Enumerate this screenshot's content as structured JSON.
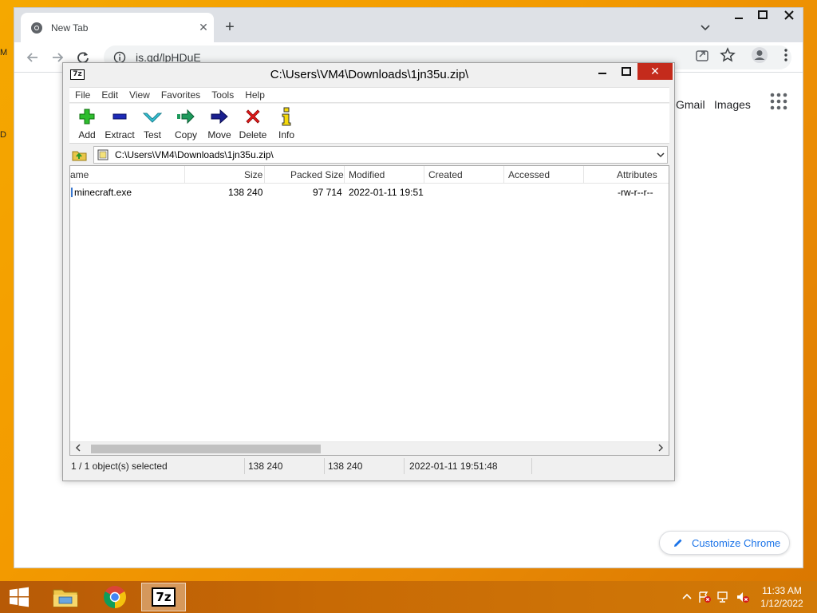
{
  "desktop": {
    "glyph_top": "M",
    "glyph_mid": "D"
  },
  "chrome": {
    "tab_title": "New Tab",
    "tab_close": "✕",
    "new_tab": "+",
    "window_minimize": "🗕",
    "window_maximize": "🗖",
    "window_close": "✕",
    "url": "is.qd/lpHDuE",
    "ntp_links": {
      "gmail": "Gmail",
      "images": "Images"
    },
    "customize_label": "Customize Chrome",
    "accent_color": "#1a73e8"
  },
  "zip": {
    "logo": "7z",
    "title": "C:\\Users\\VM4\\Downloads\\1jn35u.zip\\",
    "close_symbol": "✕",
    "menu": [
      "File",
      "Edit",
      "View",
      "Favorites",
      "Tools",
      "Help"
    ],
    "toolbar": {
      "add": "Add",
      "extract": "Extract",
      "test": "Test",
      "copy": "Copy",
      "move": "Move",
      "delete": "Delete",
      "info": "Info"
    },
    "address": "C:\\Users\\VM4\\Downloads\\1jn35u.zip\\",
    "columns": {
      "name": "ame",
      "size": "Size",
      "packed": "Packed Size",
      "modified": "Modified",
      "created": "Created",
      "accessed": "Accessed",
      "attributes": "Attributes"
    },
    "files": [
      {
        "name": "minecraft.exe",
        "size": "138 240",
        "packed": "97 714",
        "modified": "2022-01-11 19:51",
        "created": "",
        "accessed": "",
        "attributes": "-rw-r--r--"
      }
    ],
    "status": {
      "selected": "1 / 1 object(s) selected",
      "size": "138 240",
      "packed": "138 240",
      "modified": "2022-01-11 19:51:48"
    }
  },
  "taskbar": {
    "seven_zip_label": "7z",
    "time": "11:33 AM",
    "date": "1/12/2022"
  }
}
